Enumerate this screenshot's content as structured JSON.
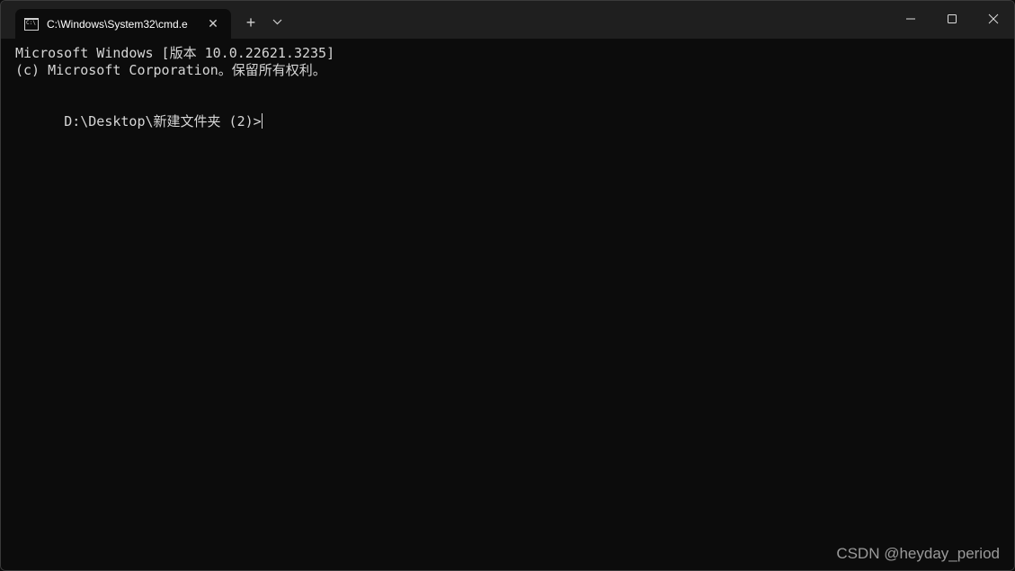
{
  "window": {
    "tab_title": "C:\\Windows\\System32\\cmd.e",
    "tab_close": "✕",
    "new_tab": "+",
    "controls": [
      "minimize-icon",
      "maximize-icon",
      "close-icon"
    ]
  },
  "terminal": {
    "lines": [
      "Microsoft Windows [版本 10.0.22621.3235]",
      "(c) Microsoft Corporation。保留所有权利。",
      "",
      "D:\\Desktop\\新建文件夹 (2)>"
    ]
  },
  "watermark": "CSDN @heyday_period",
  "colors": {
    "background": "#0c0c0c",
    "titlebar": "#1f1f1f",
    "text": "#d6d6d6"
  }
}
